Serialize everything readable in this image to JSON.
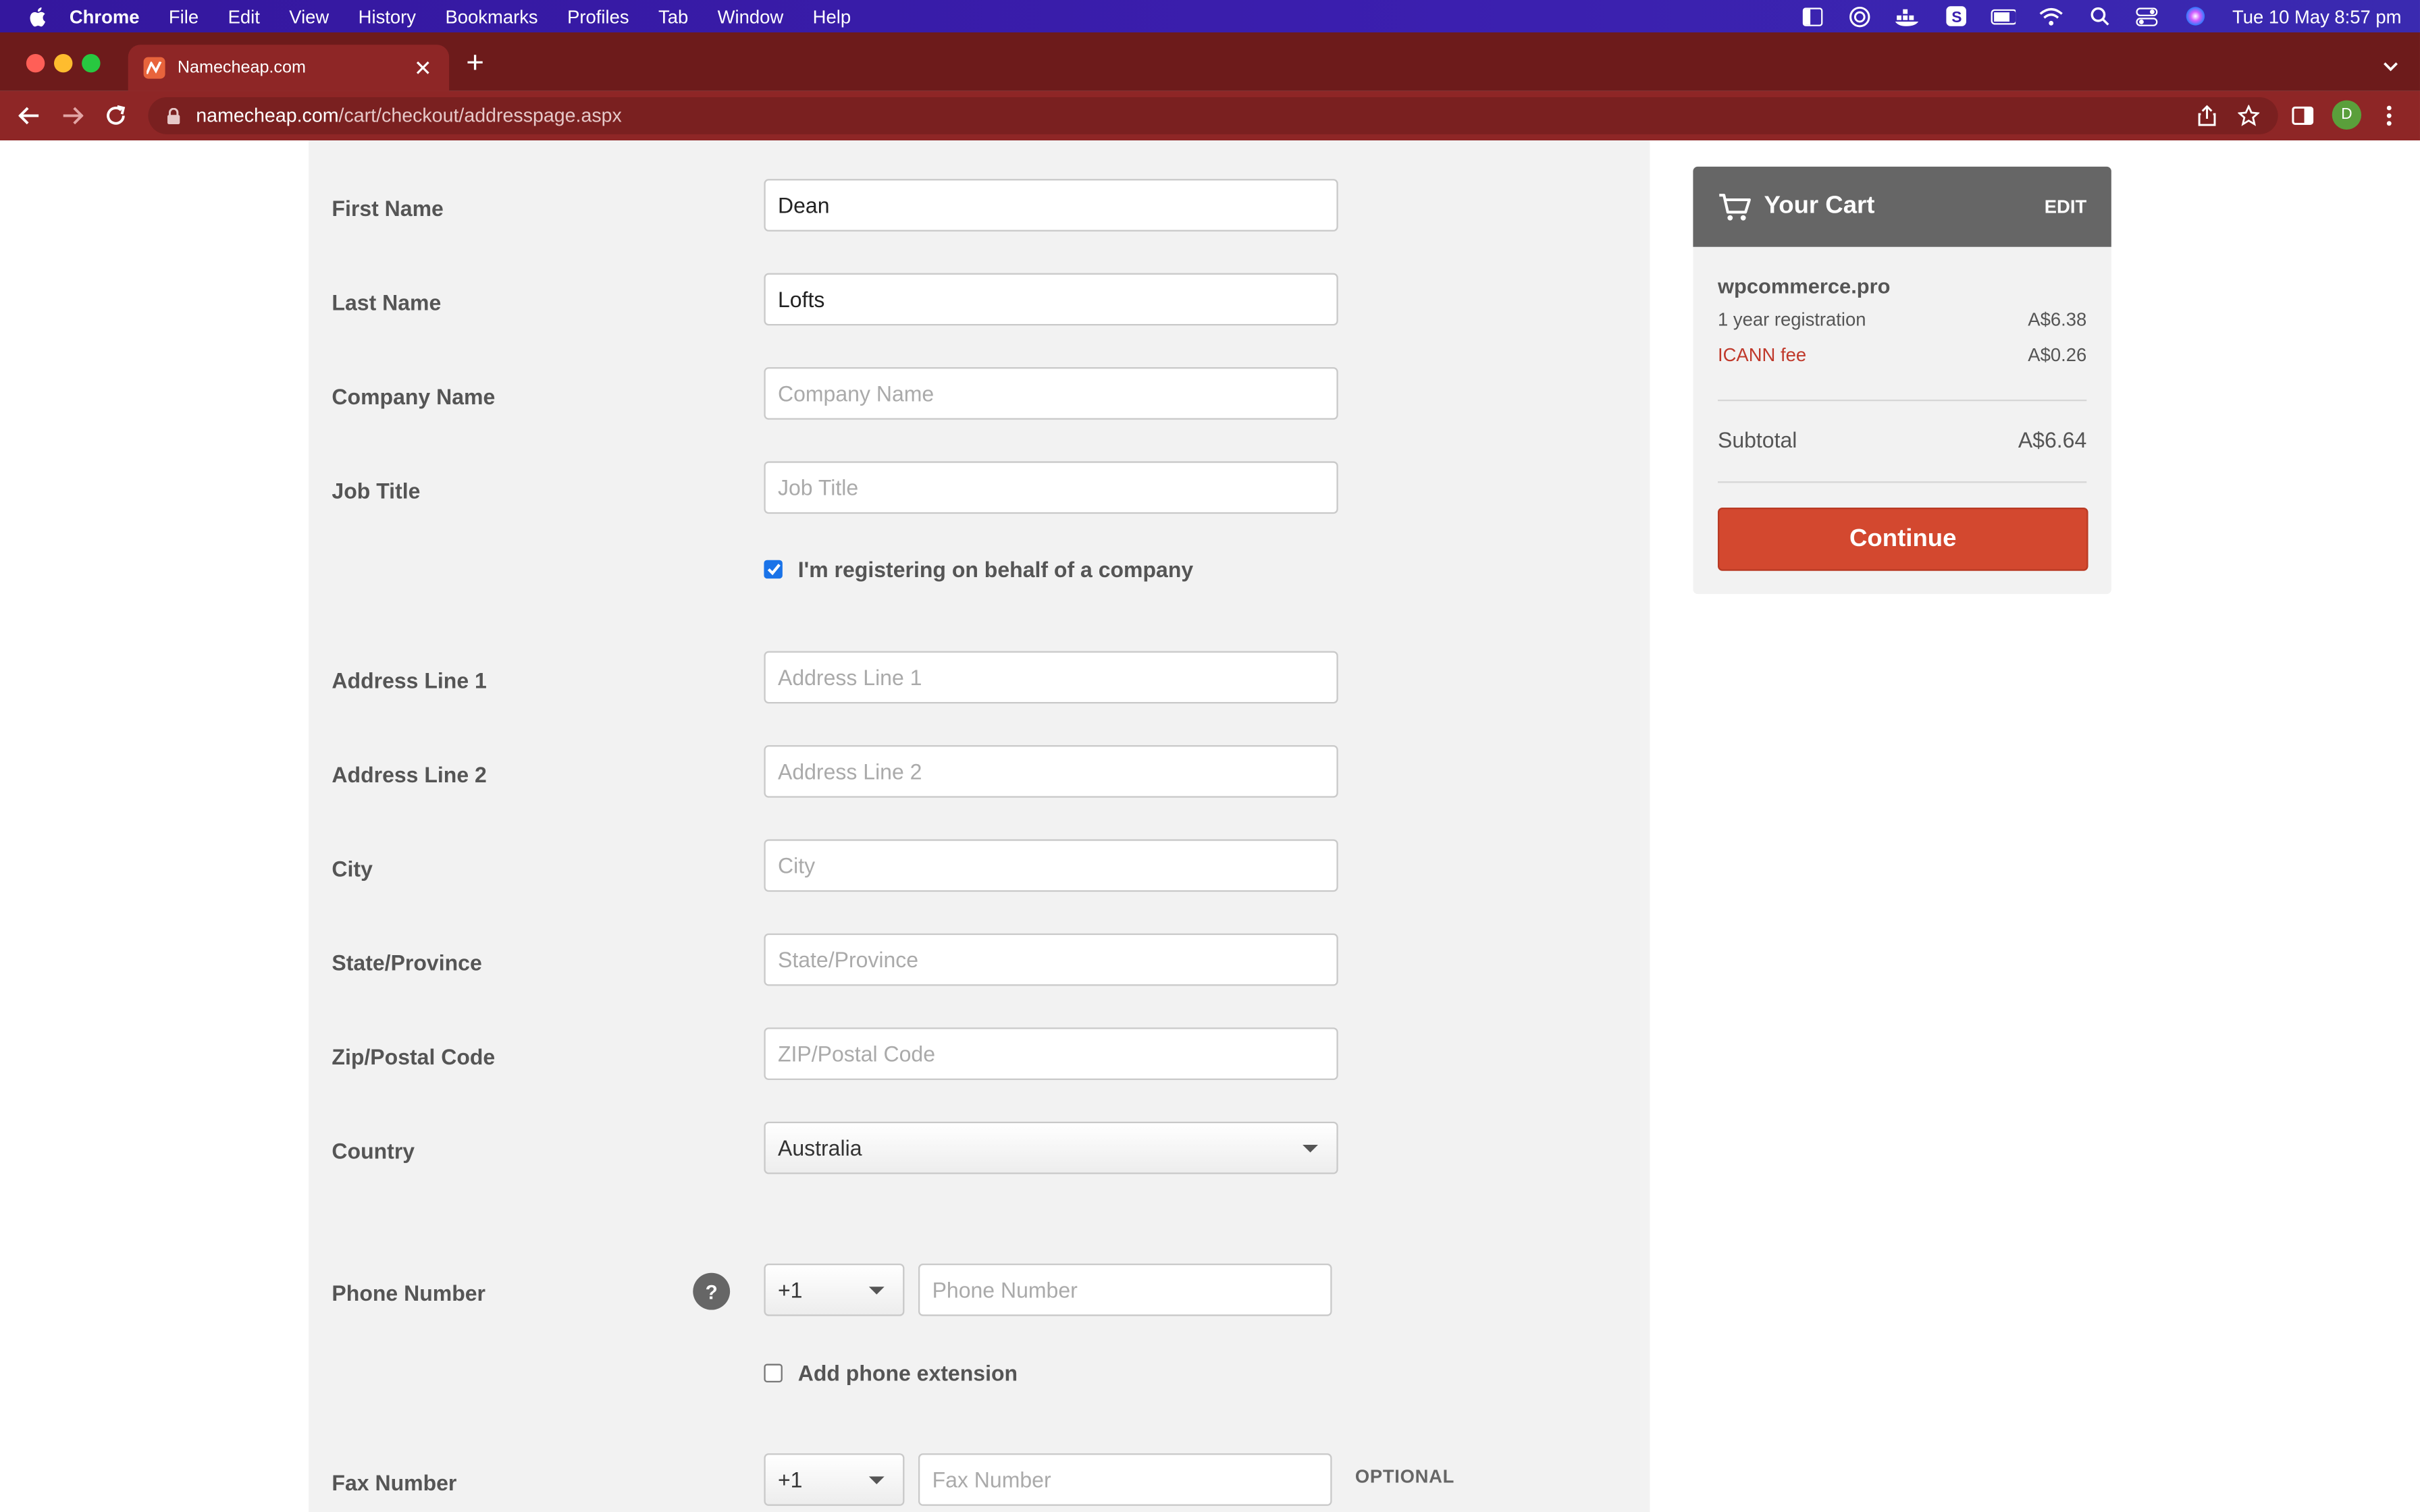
{
  "menubar": {
    "app": "Chrome",
    "items": [
      "File",
      "Edit",
      "View",
      "History",
      "Bookmarks",
      "Profiles",
      "Tab",
      "Window",
      "Help"
    ],
    "clock": "Tue 10 May  8:57 pm"
  },
  "browser": {
    "tab_title": "Namecheap.com",
    "url_host": "namecheap.com",
    "url_path": "/cart/checkout/addresspage.aspx",
    "profile_initial": "D"
  },
  "form": {
    "first_name": {
      "label": "First Name",
      "value": "Dean",
      "placeholder": "First Name"
    },
    "last_name": {
      "label": "Last Name",
      "value": "Lofts",
      "placeholder": "Last Name"
    },
    "company": {
      "label": "Company Name",
      "value": "",
      "placeholder": "Company Name"
    },
    "job_title": {
      "label": "Job Title",
      "value": "",
      "placeholder": "Job Title"
    },
    "company_checkbox": {
      "label": "I'm registering on behalf of a company",
      "checked": true
    },
    "address1": {
      "label": "Address Line 1",
      "value": "",
      "placeholder": "Address Line 1"
    },
    "address2": {
      "label": "Address Line 2",
      "value": "",
      "placeholder": "Address Line 2"
    },
    "city": {
      "label": "City",
      "value": "",
      "placeholder": "City"
    },
    "state": {
      "label": "State/Province",
      "value": "",
      "placeholder": "State/Province"
    },
    "zip": {
      "label": "Zip/Postal Code",
      "value": "",
      "placeholder": "ZIP/Postal Code"
    },
    "country": {
      "label": "Country",
      "value": "Australia"
    },
    "phone": {
      "label": "Phone Number",
      "help": "?",
      "code": "+1",
      "placeholder": "Phone Number"
    },
    "phone_ext_checkbox": {
      "label": "Add phone extension",
      "checked": false
    },
    "fax": {
      "label": "Fax Number",
      "code": "+1",
      "placeholder": "Fax Number",
      "optional": "OPTIONAL"
    }
  },
  "cart": {
    "title": "Your Cart",
    "edit": "EDIT",
    "domain": "wpcommerce.pro",
    "registration_label": "1 year registration",
    "registration_price": "A$6.38",
    "icann_label": "ICANN fee",
    "icann_price": "A$0.26",
    "subtotal_label": "Subtotal",
    "subtotal_value": "A$6.64",
    "continue_label": "Continue"
  },
  "colors": {
    "menubar": "#3b1faf",
    "browser_chrome": "#8e2626",
    "continue_button": "#d3482f",
    "icann_text": "#c0392b",
    "checkbox": "#1a73e8"
  },
  "icons": [
    "apple-icon",
    "back-icon",
    "forward-icon",
    "reload-icon",
    "lock-icon",
    "share-icon",
    "star-icon",
    "sidepanel-icon",
    "more-icon",
    "cart-icon",
    "help-icon"
  ]
}
